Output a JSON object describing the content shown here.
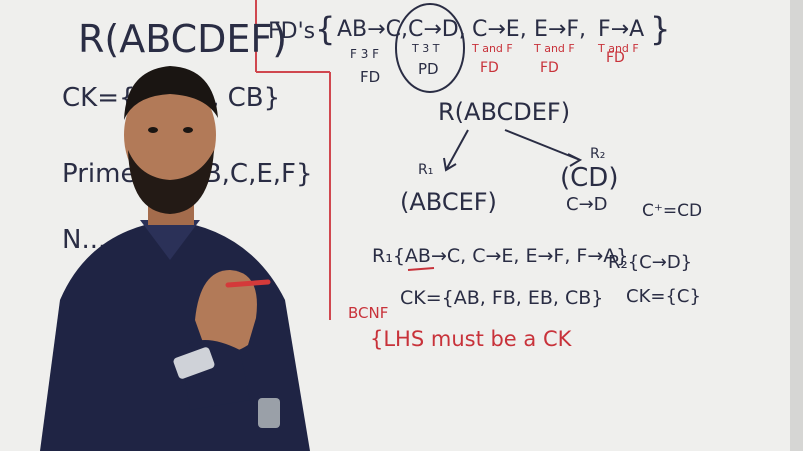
{
  "board": {
    "relation_title": "R(ABCDEF)",
    "fds_label": "FD's",
    "fds": [
      "AB→C,",
      "C→D,",
      "C→E,",
      "E→F,",
      "F→A"
    ],
    "fd_notes": [
      "F 3 F",
      "T 3 T",
      "T and F",
      "T and F",
      "T and F"
    ],
    "fd_tags": [
      "FD",
      "PD",
      "FD",
      "FD",
      "FD"
    ],
    "ck_line": "CK={ ... EB, CB}",
    "prime_line": "Prime ... A,B,C,E,F}",
    "nonprime_line": "N...",
    "decomp_root": "R(ABCDEF)",
    "r1_label": "R₁",
    "r1_attrs": "(ABCEF)",
    "r2_label": "R₂",
    "r2_attrs": "(CD)",
    "r2_fd_small": "C→D",
    "closure": "C⁺=CD",
    "r1_fds": "R₁{AB→C, C→E, E→F, F→A}",
    "r1_ck": "CK={AB, FB, EB, CB}",
    "r2_fds": "R₂{C→D}",
    "r2_ck": "CK={C}",
    "bcnf_label": "BCNF",
    "bcnf_rule": "{LHS must be a CK"
  }
}
